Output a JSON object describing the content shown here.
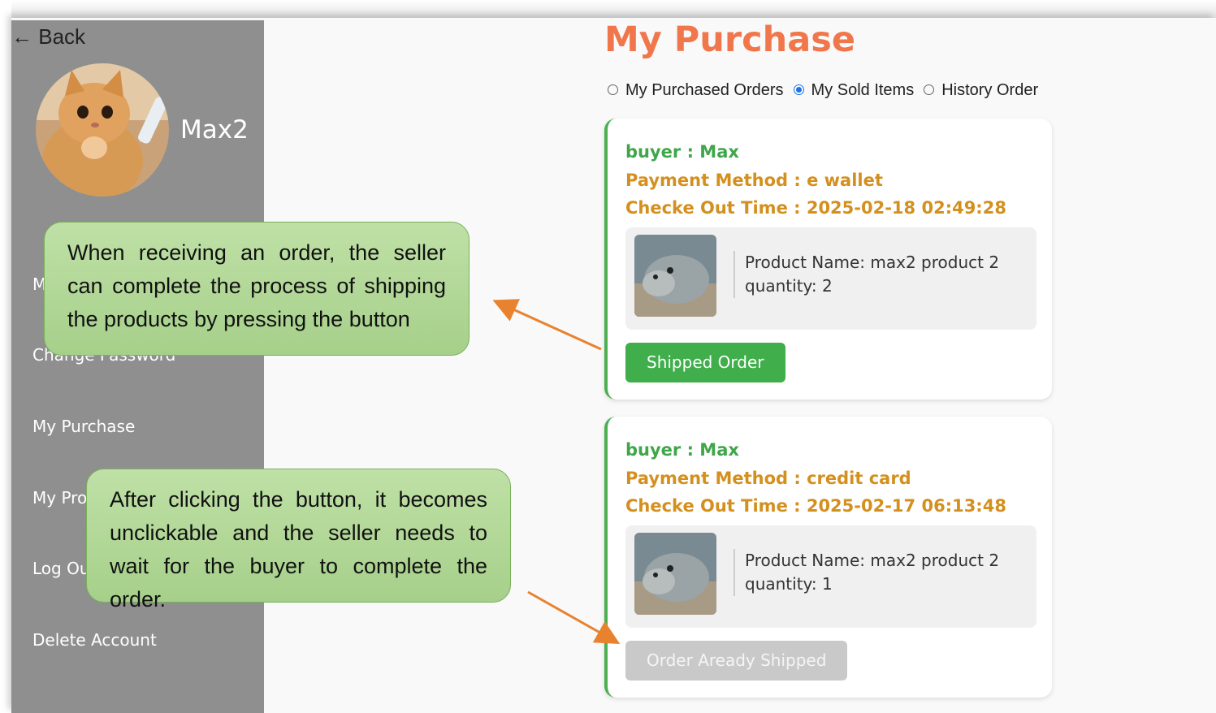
{
  "nav": {
    "back_label": "← Back"
  },
  "profile": {
    "username": "Max2"
  },
  "sidebar": {
    "items": [
      {
        "label": "M"
      },
      {
        "label": "Change Password"
      },
      {
        "label": "My Purchase"
      },
      {
        "label": "My Pro"
      },
      {
        "label": "Log Ou"
      },
      {
        "label": "Delete Account"
      }
    ]
  },
  "page": {
    "title": "My Purchase"
  },
  "filters": [
    {
      "label": "My Purchased Orders",
      "selected": false
    },
    {
      "label": "My Sold Items",
      "selected": true
    },
    {
      "label": "History Order",
      "selected": false
    }
  ],
  "orders": [
    {
      "buyer": "buyer : Max",
      "payment": "Payment Method : e wallet",
      "checkout": "Checke Out Time : 2025-02-18 02:49:28",
      "product_name": "Product Name: max2 product 2",
      "quantity": "quantity: 2",
      "button": "Shipped Order",
      "button_enabled": true
    },
    {
      "buyer": "buyer : Max",
      "payment": "Payment Method : credit card",
      "checkout": "Checke Out Time : 2025-02-17 06:13:48",
      "product_name": "Product Name: max2 product 2",
      "quantity": "quantity: 1",
      "button": "Order Aready Shipped",
      "button_enabled": false
    }
  ],
  "callouts": [
    {
      "text": "When receiving an order, the seller can complete the process of shipping the products by pressing the button"
    },
    {
      "text": "After clicking the button, it becomes unclickable and the seller needs to wait for the buyer to complete the order."
    }
  ],
  "colors": {
    "accent_title": "#f0774b",
    "buyer_green": "#3fa64a",
    "meta_gold": "#d4901e",
    "button_green": "#3fae4b",
    "arrow": "#e8822f"
  }
}
